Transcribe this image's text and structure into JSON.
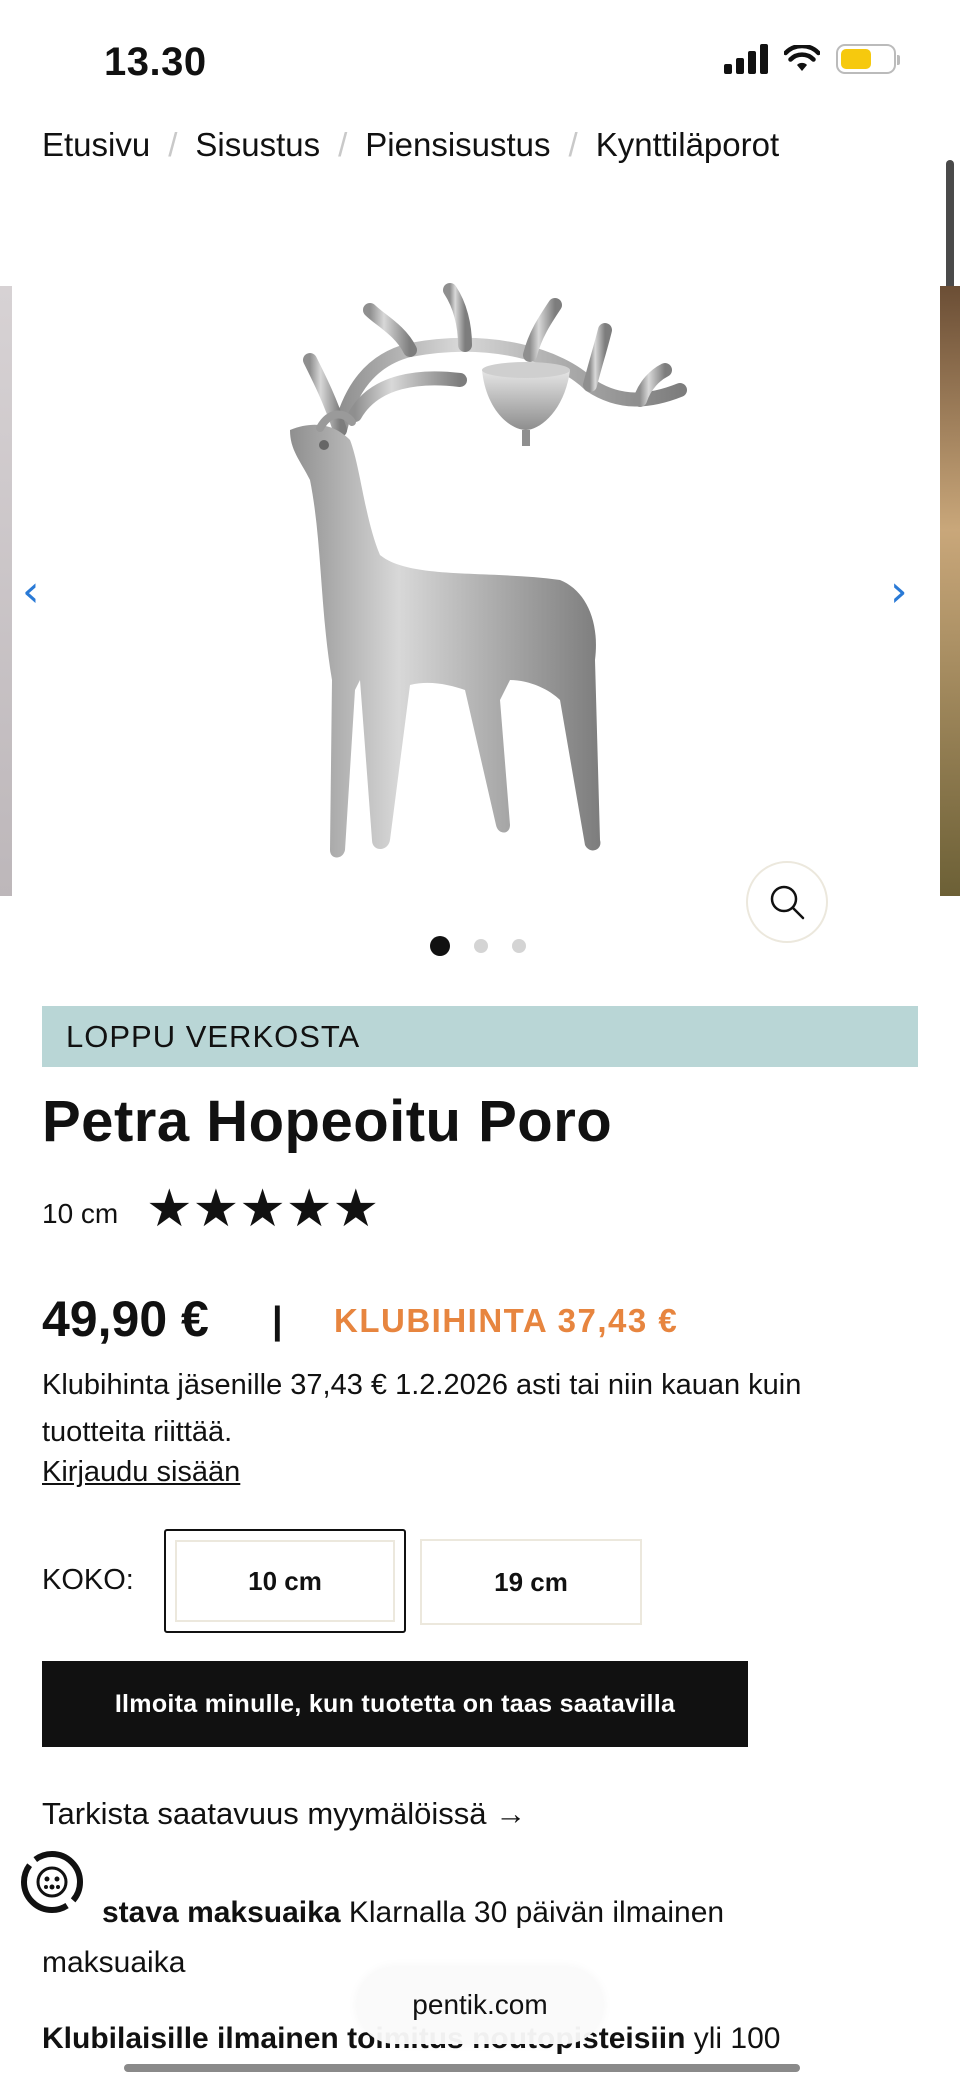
{
  "status_bar": {
    "time": "13.30"
  },
  "breadcrumb": [
    {
      "label": "Etusivu"
    },
    {
      "label": "Sisustus"
    },
    {
      "label": "Piensisustus"
    },
    {
      "label": "Kynttiläporot"
    }
  ],
  "gallery": {
    "prev_arrow": "‹",
    "next_arrow": "›",
    "active_index": 0,
    "image_count": 3
  },
  "product": {
    "badge": "LOPPU VERKOSTA",
    "title": "Petra Hopeoitu Poro",
    "size": "10 cm",
    "rating": 5,
    "stars": "★★★★★",
    "price": "49,90 €",
    "price_separator": "|",
    "club_price_label": "KLUBIHINTA 37,43 €",
    "club_price_desc": "Klubihinta jäsenille 37,43 € 1.2.2026 asti tai niin kauan kuin tuotteita riittää.",
    "login_link": "Kirjaudu sisään"
  },
  "size_selector": {
    "label": "KOKO:",
    "options": [
      {
        "label": "10 cm",
        "selected": true
      },
      {
        "label": "19 cm",
        "selected": false
      }
    ]
  },
  "notify_button": "Ilmoita minulle, kun tuotetta on taas saatavilla",
  "check_stores_link": "Tarkista saatavuus myymälöissä →",
  "payment": {
    "bold": "stava maksuaika",
    "rest": " Klarnalla 30 päivän ilmainen",
    "line2": "maksuaika"
  },
  "shipping": {
    "bold": "Klubilaisille ilmainen toimitus noutopisteisiin",
    "rest": " yli 100"
  },
  "browser": {
    "url": "pentik.com"
  },
  "colors": {
    "badge_bg": "#b9d6d6",
    "club_price": "#e7853f",
    "arrow": "#2a7ad6",
    "button_bg": "#111111"
  }
}
